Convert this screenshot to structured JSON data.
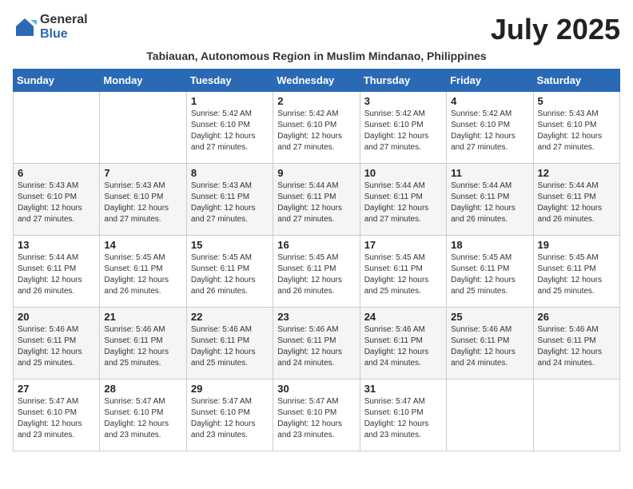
{
  "logo": {
    "general": "General",
    "blue": "Blue"
  },
  "title": "July 2025",
  "subtitle": "Tabiauan, Autonomous Region in Muslim Mindanao, Philippines",
  "days_of_week": [
    "Sunday",
    "Monday",
    "Tuesday",
    "Wednesday",
    "Thursday",
    "Friday",
    "Saturday"
  ],
  "weeks": [
    [
      {
        "day": "",
        "info": ""
      },
      {
        "day": "",
        "info": ""
      },
      {
        "day": "1",
        "info": "Sunrise: 5:42 AM\nSunset: 6:10 PM\nDaylight: 12 hours and 27 minutes."
      },
      {
        "day": "2",
        "info": "Sunrise: 5:42 AM\nSunset: 6:10 PM\nDaylight: 12 hours and 27 minutes."
      },
      {
        "day": "3",
        "info": "Sunrise: 5:42 AM\nSunset: 6:10 PM\nDaylight: 12 hours and 27 minutes."
      },
      {
        "day": "4",
        "info": "Sunrise: 5:42 AM\nSunset: 6:10 PM\nDaylight: 12 hours and 27 minutes."
      },
      {
        "day": "5",
        "info": "Sunrise: 5:43 AM\nSunset: 6:10 PM\nDaylight: 12 hours and 27 minutes."
      }
    ],
    [
      {
        "day": "6",
        "info": "Sunrise: 5:43 AM\nSunset: 6:10 PM\nDaylight: 12 hours and 27 minutes."
      },
      {
        "day": "7",
        "info": "Sunrise: 5:43 AM\nSunset: 6:10 PM\nDaylight: 12 hours and 27 minutes."
      },
      {
        "day": "8",
        "info": "Sunrise: 5:43 AM\nSunset: 6:11 PM\nDaylight: 12 hours and 27 minutes."
      },
      {
        "day": "9",
        "info": "Sunrise: 5:44 AM\nSunset: 6:11 PM\nDaylight: 12 hours and 27 minutes."
      },
      {
        "day": "10",
        "info": "Sunrise: 5:44 AM\nSunset: 6:11 PM\nDaylight: 12 hours and 27 minutes."
      },
      {
        "day": "11",
        "info": "Sunrise: 5:44 AM\nSunset: 6:11 PM\nDaylight: 12 hours and 26 minutes."
      },
      {
        "day": "12",
        "info": "Sunrise: 5:44 AM\nSunset: 6:11 PM\nDaylight: 12 hours and 26 minutes."
      }
    ],
    [
      {
        "day": "13",
        "info": "Sunrise: 5:44 AM\nSunset: 6:11 PM\nDaylight: 12 hours and 26 minutes."
      },
      {
        "day": "14",
        "info": "Sunrise: 5:45 AM\nSunset: 6:11 PM\nDaylight: 12 hours and 26 minutes."
      },
      {
        "day": "15",
        "info": "Sunrise: 5:45 AM\nSunset: 6:11 PM\nDaylight: 12 hours and 26 minutes."
      },
      {
        "day": "16",
        "info": "Sunrise: 5:45 AM\nSunset: 6:11 PM\nDaylight: 12 hours and 26 minutes."
      },
      {
        "day": "17",
        "info": "Sunrise: 5:45 AM\nSunset: 6:11 PM\nDaylight: 12 hours and 25 minutes."
      },
      {
        "day": "18",
        "info": "Sunrise: 5:45 AM\nSunset: 6:11 PM\nDaylight: 12 hours and 25 minutes."
      },
      {
        "day": "19",
        "info": "Sunrise: 5:45 AM\nSunset: 6:11 PM\nDaylight: 12 hours and 25 minutes."
      }
    ],
    [
      {
        "day": "20",
        "info": "Sunrise: 5:46 AM\nSunset: 6:11 PM\nDaylight: 12 hours and 25 minutes."
      },
      {
        "day": "21",
        "info": "Sunrise: 5:46 AM\nSunset: 6:11 PM\nDaylight: 12 hours and 25 minutes."
      },
      {
        "day": "22",
        "info": "Sunrise: 5:46 AM\nSunset: 6:11 PM\nDaylight: 12 hours and 25 minutes."
      },
      {
        "day": "23",
        "info": "Sunrise: 5:46 AM\nSunset: 6:11 PM\nDaylight: 12 hours and 24 minutes."
      },
      {
        "day": "24",
        "info": "Sunrise: 5:46 AM\nSunset: 6:11 PM\nDaylight: 12 hours and 24 minutes."
      },
      {
        "day": "25",
        "info": "Sunrise: 5:46 AM\nSunset: 6:11 PM\nDaylight: 12 hours and 24 minutes."
      },
      {
        "day": "26",
        "info": "Sunrise: 5:46 AM\nSunset: 6:11 PM\nDaylight: 12 hours and 24 minutes."
      }
    ],
    [
      {
        "day": "27",
        "info": "Sunrise: 5:47 AM\nSunset: 6:10 PM\nDaylight: 12 hours and 23 minutes."
      },
      {
        "day": "28",
        "info": "Sunrise: 5:47 AM\nSunset: 6:10 PM\nDaylight: 12 hours and 23 minutes."
      },
      {
        "day": "29",
        "info": "Sunrise: 5:47 AM\nSunset: 6:10 PM\nDaylight: 12 hours and 23 minutes."
      },
      {
        "day": "30",
        "info": "Sunrise: 5:47 AM\nSunset: 6:10 PM\nDaylight: 12 hours and 23 minutes."
      },
      {
        "day": "31",
        "info": "Sunrise: 5:47 AM\nSunset: 6:10 PM\nDaylight: 12 hours and 23 minutes."
      },
      {
        "day": "",
        "info": ""
      },
      {
        "day": "",
        "info": ""
      }
    ]
  ]
}
